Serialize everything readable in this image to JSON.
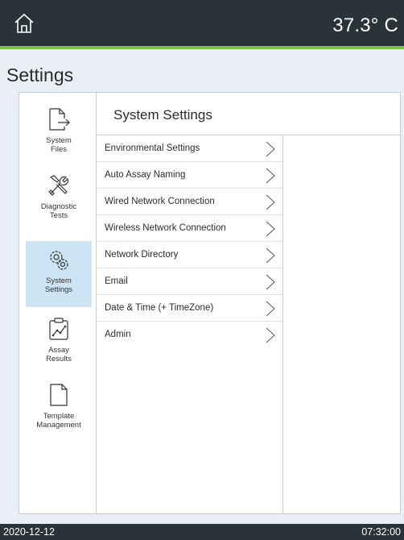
{
  "header": {
    "temperature": "37.3° C",
    "home_icon": "home-icon"
  },
  "page": {
    "title": "Settings"
  },
  "nav": {
    "items": [
      {
        "label": "System\nFiles",
        "icon": "file-export-icon"
      },
      {
        "label": "Diagnostic\nTests",
        "icon": "tools-icon"
      },
      {
        "label": "System\nSettings",
        "icon": "gears-icon"
      },
      {
        "label": "Assay\nResults",
        "icon": "chart-clipboard-icon"
      },
      {
        "label": "Template\nManagement",
        "icon": "document-icon"
      }
    ]
  },
  "content": {
    "title": "System Settings",
    "items": [
      {
        "label": "Environmental Settings"
      },
      {
        "label": "Auto Assay Naming"
      },
      {
        "label": "Wired Network Connection"
      },
      {
        "label": "Wireless Network Connection"
      },
      {
        "label": "Network Directory"
      },
      {
        "label": "Email"
      },
      {
        "label": "Date & Time (+ TimeZone)"
      },
      {
        "label": "Admin"
      }
    ]
  },
  "status": {
    "date": "2020-12-12",
    "time": "07:32:00"
  },
  "colors": {
    "topbar": "#2b333a",
    "accent": "#7ac143",
    "active_nav": "#cce4f3",
    "background": "#e9eff4"
  }
}
